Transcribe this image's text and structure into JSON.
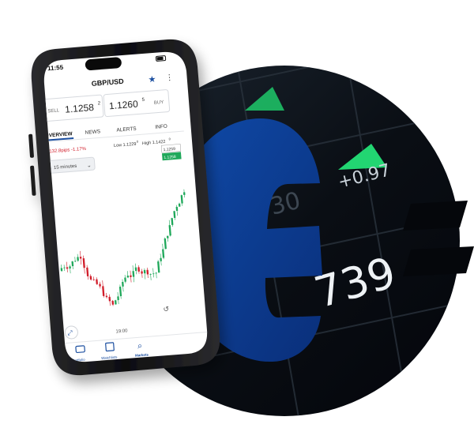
{
  "phone": {
    "status_time": "11:55",
    "pair_title": "GBP/USD",
    "sell_label": "SELL",
    "sell_price": "1.1258",
    "sell_sup": "2",
    "buy_price": "1.1260",
    "buy_sup": "5",
    "buy_label": "BUY",
    "tabs": [
      "OVERVIEW",
      "NEWS",
      "ALERTS",
      "INFO"
    ],
    "change_text": "-132.8pips -1.17%",
    "low_text": "Low 1.1229",
    "low_sup": "0",
    "high_text": "High 1.1422",
    "high_sup": "0",
    "interval": "15 minutes",
    "price_tag_top": "1.1259",
    "price_tag_green": "1.1258",
    "time_label": "19:00",
    "bottom_nav": [
      "Portfolio",
      "Watchlists",
      "Markets"
    ]
  },
  "background_screen": {
    "value_large": "739",
    "value_small": "+0.97",
    "value_faint": "30"
  },
  "colors": {
    "brand_blue": "#0c3c96",
    "up_green": "#1fa85a",
    "down_red": "#d11d2a",
    "dark": "#05070b"
  },
  "icons": [
    "back-chevron-icon",
    "star-icon",
    "more-icon",
    "chevron-down-icon",
    "expand-icon",
    "reset-icon",
    "briefcase-icon",
    "watchlist-icon",
    "search-icon"
  ]
}
